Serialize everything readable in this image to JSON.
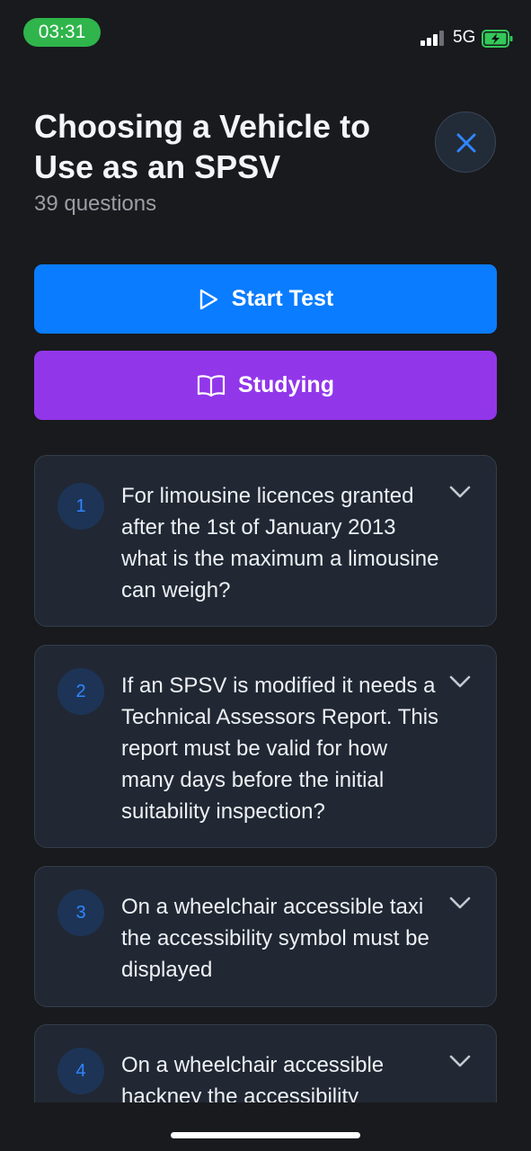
{
  "status_bar": {
    "time": "03:31",
    "network": "5G",
    "battery_icon": "battery-charging-icon",
    "signal_icon": "cellular-signal-icon"
  },
  "header": {
    "title": "Choosing a Vehicle to Use as an SPSV",
    "subtitle": "39 questions",
    "close_icon": "close-icon"
  },
  "actions": {
    "start_label": "Start Test",
    "start_icon": "play-icon",
    "study_label": "Studying",
    "study_icon": "book-open-icon"
  },
  "questions": [
    {
      "number": "1",
      "text": "For limousine licences granted after the 1st of January 2013 what is the maximum a limousine can weigh?"
    },
    {
      "number": "2",
      "text": "If an SPSV is modified it needs a Technical Assessors Report. This report must be valid for how many days before the initial suitability inspection?"
    },
    {
      "number": "3",
      "text": "On a wheelchair accessible taxi the accessibility symbol must be displayed"
    },
    {
      "number": "4",
      "text": "On a wheelchair accessible hackney the accessibility"
    }
  ],
  "colors": {
    "background": "#181a1d",
    "primary": "#0a7cff",
    "study": "#9236ea",
    "card": "#212834",
    "status_time": "#2fb54b"
  }
}
